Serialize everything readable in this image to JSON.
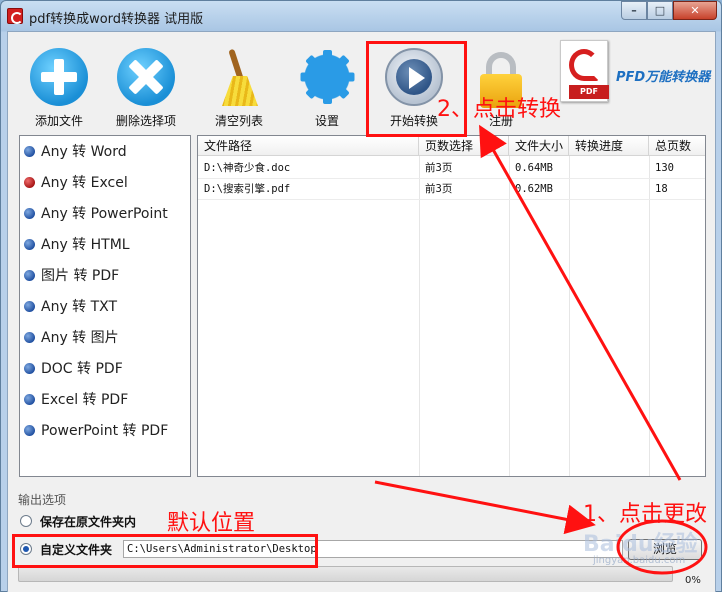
{
  "window": {
    "title": "pdf转换成word转换器 试用版",
    "min_label": "–",
    "max_label": "□",
    "close_label": "✕"
  },
  "toolbar": {
    "add_file": "添加文件",
    "delete_selected": "删除选择项",
    "clear_list": "清空列表",
    "settings": "设置",
    "start_convert": "开始转换",
    "register": "注册",
    "pdf_badge": "PDF",
    "brand": "PFD万能转换器"
  },
  "conversions": [
    {
      "label": "Any 转 Word",
      "selected": false
    },
    {
      "label": "Any 转 Excel",
      "selected": true
    },
    {
      "label": "Any 转 PowerPoint",
      "selected": false
    },
    {
      "label": "Any 转 HTML",
      "selected": false
    },
    {
      "label": "图片 转 PDF",
      "selected": false
    },
    {
      "label": "Any 转 TXT",
      "selected": false
    },
    {
      "label": "Any 转 图片",
      "selected": false
    },
    {
      "label": "DOC 转 PDF",
      "selected": false
    },
    {
      "label": "Excel 转 PDF",
      "selected": false
    },
    {
      "label": "PowerPoint 转 PDF",
      "selected": false
    }
  ],
  "table": {
    "headers": [
      "文件路径",
      "页数选择",
      "文件大小",
      "转换进度",
      "总页数"
    ],
    "rows": [
      {
        "path": "D:\\神奇少食.doc",
        "pages_sel": "前3页",
        "size": "0.64MB",
        "progress": "",
        "total": "130"
      },
      {
        "path": "D:\\搜索引擎.pdf",
        "pages_sel": "前3页",
        "size": "0.62MB",
        "progress": "",
        "total": "18"
      }
    ]
  },
  "output": {
    "section_label": "输出选项",
    "option_original": "保存在原文件夹内",
    "option_custom": "自定义文件夹",
    "custom_selected": true,
    "path": "C:\\Users\\Administrator\\Desktop",
    "change_button": "浏览",
    "progress_fraction": 0,
    "progress_text": "0%"
  },
  "annotations": {
    "step1": "1、点击更改",
    "step2": "2、点击转换",
    "default_location": "默认位置",
    "color": "#ff1111"
  },
  "watermark": {
    "text": "Baidu经验",
    "url": "jingyan.baidu.com"
  }
}
